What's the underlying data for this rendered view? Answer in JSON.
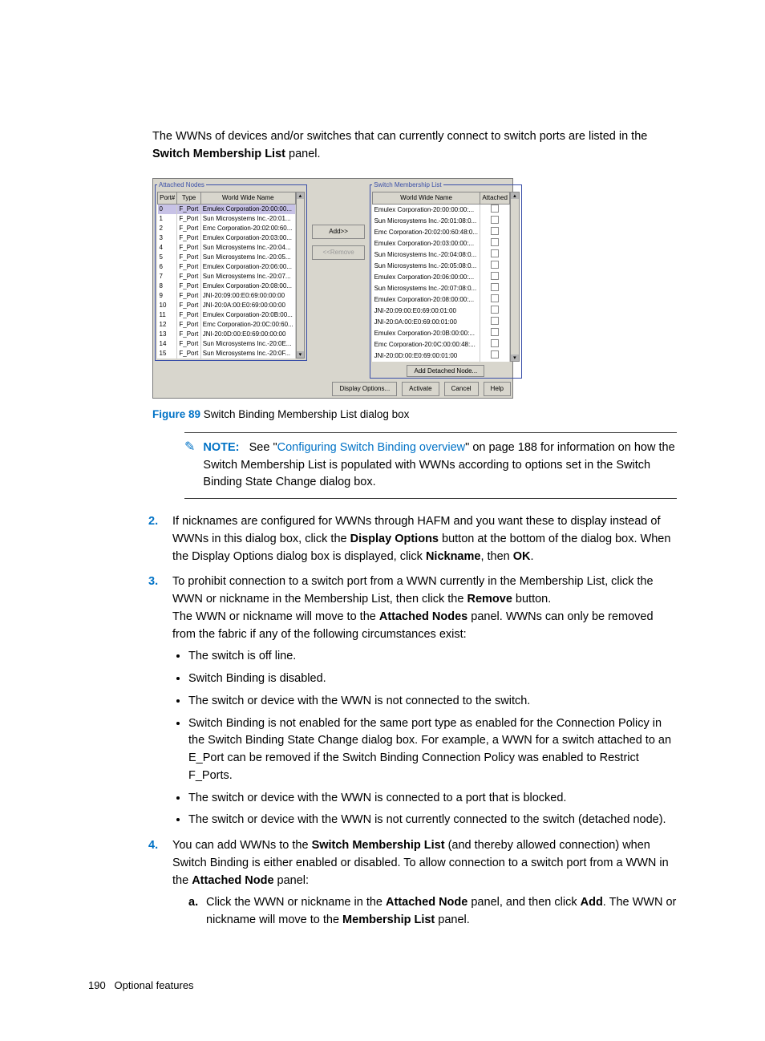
{
  "intro": {
    "line1_pre": "The WWNs of devices and/or switches that can currently connect to switch ports are listed in the ",
    "line1_bold": "Switch Membership List",
    "line1_post": " panel."
  },
  "panel": {
    "attached_legend": "Attached Nodes",
    "membership_legend": "Switch Membership List",
    "cols_attached": {
      "port": "Port#",
      "type": "Type",
      "wwn": "World Wide Name"
    },
    "cols_member": {
      "wwn": "World Wide Name",
      "attached": "Attached"
    },
    "add_btn": "Add>>",
    "remove_btn": "<<Remove",
    "add_detached_btn": "Add Detached Node...",
    "attached_rows": [
      {
        "p": "0",
        "t": "F_Port",
        "w": "Emulex Corporation-20:00:00..."
      },
      {
        "p": "1",
        "t": "F_Port",
        "w": "Sun Microsystems Inc.-20:01..."
      },
      {
        "p": "2",
        "t": "F_Port",
        "w": "Emc Corporation-20:02:00:60..."
      },
      {
        "p": "3",
        "t": "F_Port",
        "w": "Emulex Corporation-20:03:00..."
      },
      {
        "p": "4",
        "t": "F_Port",
        "w": "Sun Microsystems Inc.-20:04..."
      },
      {
        "p": "5",
        "t": "F_Port",
        "w": "Sun Microsystems Inc.-20:05..."
      },
      {
        "p": "6",
        "t": "F_Port",
        "w": "Emulex Corporation-20:06:00..."
      },
      {
        "p": "7",
        "t": "F_Port",
        "w": "Sun Microsystems Inc.-20:07..."
      },
      {
        "p": "8",
        "t": "F_Port",
        "w": "Emulex Corporation-20:08:00..."
      },
      {
        "p": "9",
        "t": "F_Port",
        "w": "JNI-20:09:00:E0:69:00:00:00"
      },
      {
        "p": "10",
        "t": "F_Port",
        "w": "JNI-20:0A:00:E0:69:00:00:00"
      },
      {
        "p": "11",
        "t": "F_Port",
        "w": "Emulex Corporation-20:0B:00..."
      },
      {
        "p": "12",
        "t": "F_Port",
        "w": "Emc Corporation-20:0C:00:60..."
      },
      {
        "p": "13",
        "t": "F_Port",
        "w": "JNI-20:0D:00:E0:69:00:00:00"
      },
      {
        "p": "14",
        "t": "F_Port",
        "w": "Sun Microsystems Inc.-20:0E..."
      },
      {
        "p": "15",
        "t": "F_Port",
        "w": "Sun Microsystems Inc.-20:0F..."
      }
    ],
    "member_rows": [
      {
        "w": "Emulex Corporation-20:00:00:00:..."
      },
      {
        "w": "Sun Microsystems Inc.-20:01:08:0..."
      },
      {
        "w": "Emc Corporation-20:02:00:60:48:0..."
      },
      {
        "w": "Emulex Corporation-20:03:00:00:..."
      },
      {
        "w": "Sun Microsystems Inc.-20:04:08:0..."
      },
      {
        "w": "Sun Microsystems Inc.-20:05:08:0..."
      },
      {
        "w": "Emulex Corporation-20:06:00:00:..."
      },
      {
        "w": "Sun Microsystems Inc.-20:07:08:0..."
      },
      {
        "w": "Emulex Corporation-20:08:00:00:..."
      },
      {
        "w": "JNI-20:09:00:E0:69:00:01:00"
      },
      {
        "w": "JNI-20:0A:00:E0:69:00:01:00"
      },
      {
        "w": "Emulex Corporation-20:0B:00:00:..."
      },
      {
        "w": "Emc Corporation-20:0C:00:00:48:..."
      },
      {
        "w": "JNI-20:0D:00:E0:69:00:01:00"
      }
    ],
    "buttons": {
      "display_options": "Display Options...",
      "activate": "Activate",
      "cancel": "Cancel",
      "help": "Help"
    }
  },
  "caption": {
    "label": "Figure 89",
    "text": "Switch Binding Membership List dialog box"
  },
  "note": {
    "label": "NOTE:",
    "pre": "See \"",
    "link": "Configuring Switch Binding overview",
    "post": "\" on page 188 for information on how the Switch Membership List is populated with WWNs according to options set in the Switch Binding State Change dialog box."
  },
  "steps": {
    "s2": {
      "num": "2.",
      "t1": "If nicknames are configured for WWNs through HAFM and you want these to display instead of WWNs in this dialog box, click the ",
      "b1": "Display Options",
      "t2": " button at the bottom of the dialog box. When the Display Options dialog box is displayed, click ",
      "b2": "Nickname",
      "t3": ", then ",
      "b3": "OK",
      "t4": "."
    },
    "s3": {
      "num": "3.",
      "t1": "To prohibit connection to a switch port from a WWN currently in the Membership List, click the WWN or nickname in the Membership List, then click the ",
      "b1": "Remove",
      "t2": " button.",
      "t3a": "The WWN or nickname will move to the ",
      "t3b": "Attached Nodes",
      "t3c": " panel. WWNs can only be removed from the fabric if any of the following circumstances exist:",
      "bul1": "The switch is off line.",
      "bul2": "Switch Binding is disabled.",
      "bul3": "The switch or device with the WWN is not connected to the switch.",
      "bul4": "Switch Binding is not enabled for the same port type as enabled for the Connection Policy in the Switch Binding State Change dialog box. For example, a WWN for a switch attached to an E_Port can be removed if the Switch Binding Connection Policy was enabled to Restrict F_Ports.",
      "bul5": "The switch or device with the WWN is connected to a port that is blocked.",
      "bul6": "The switch or device with the WWN is not currently connected to the switch (detached node)."
    },
    "s4": {
      "num": "4.",
      "t1": "You can add WWNs to the ",
      "b1": "Switch Membership List",
      "t2": " (and thereby allowed connection) when Switch Binding is either enabled or disabled. To allow connection to a switch port from a WWN in the ",
      "b2": "Attached Node",
      "t3": " panel:",
      "sa_num": "a.",
      "sa_t1": "Click the WWN or nickname in the ",
      "sa_b1": "Attached Node",
      "sa_t2": " panel, and then click ",
      "sa_b2": "Add",
      "sa_t3": ". The WWN or nickname will move to the ",
      "sa_b3": "Membership List",
      "sa_t4": " panel."
    }
  },
  "footer": {
    "page": "190",
    "section": "Optional features"
  }
}
